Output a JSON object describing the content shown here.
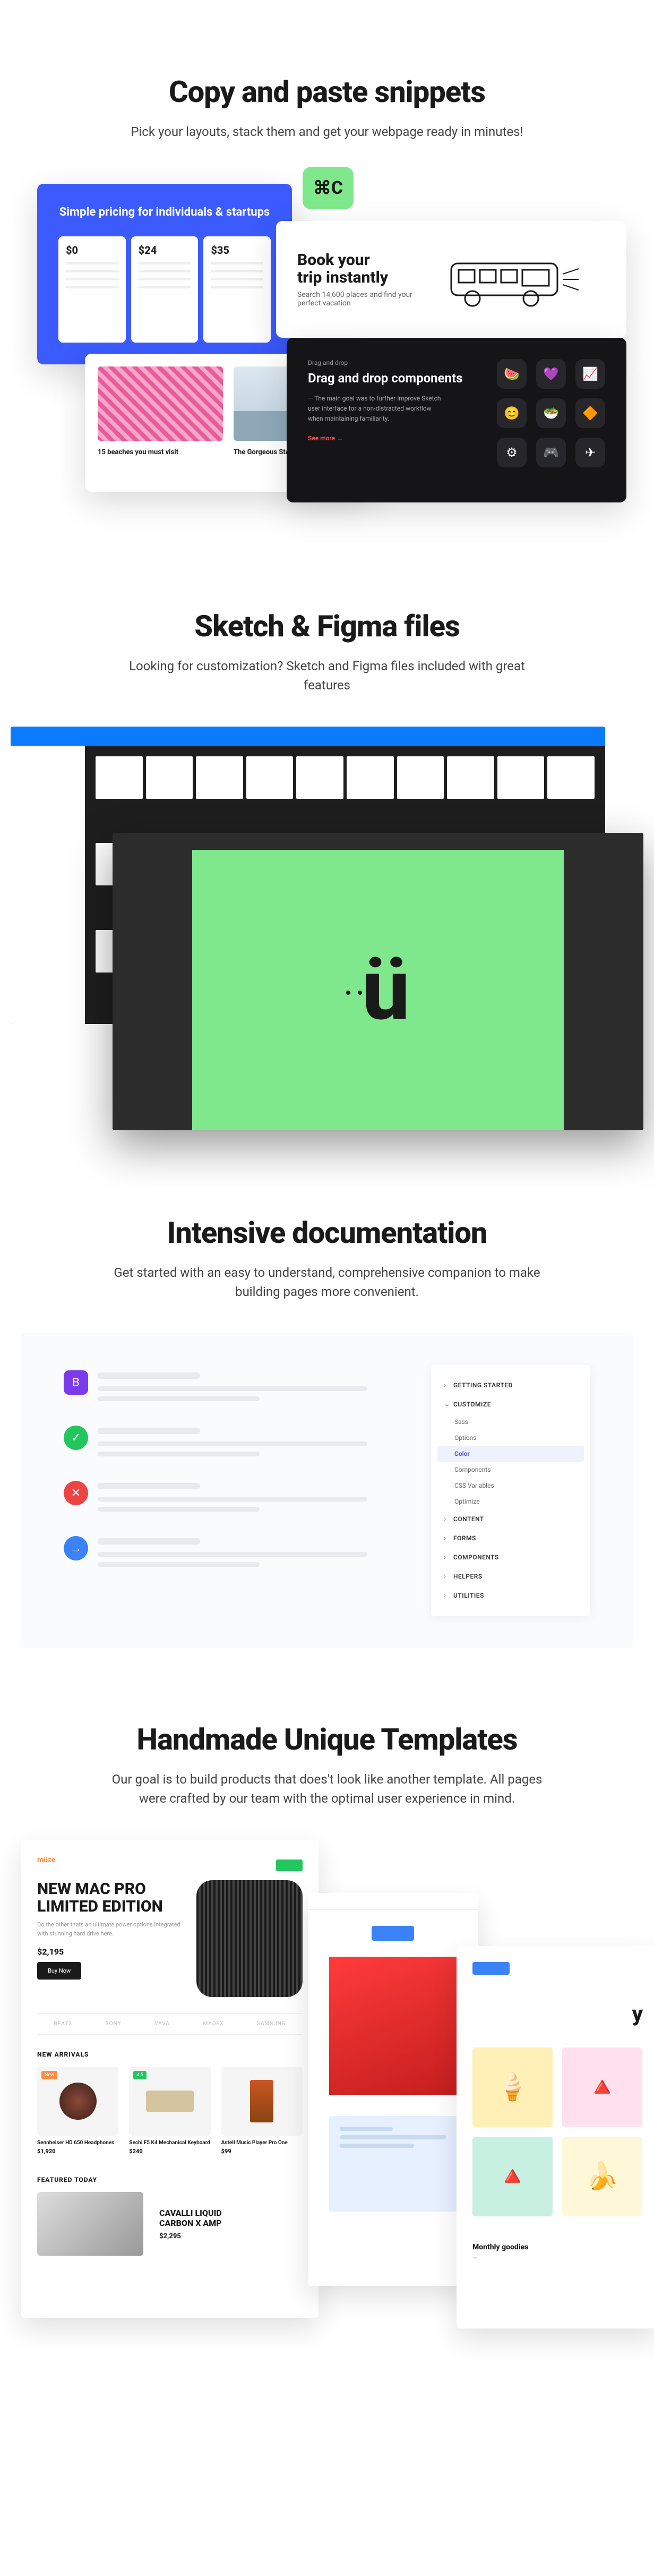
{
  "sec1": {
    "title": "Copy and paste snippets",
    "sub": "Pick your layouts, stack them and get your webpage ready in minutes!",
    "pricing_heading": "Simple pricing for individuals & startups",
    "prices": [
      "$0",
      "$24",
      "$35"
    ],
    "badge": "⌘C",
    "trip_title_l1": "Book your",
    "trip_title_l2": "trip instantly",
    "trip_sub": "Search 14,600 places and find your perfect vacation",
    "beach_cap1": "15 beaches you must visit",
    "beach_cap2": "The Gorgeous Statue Thailand",
    "dark_eyebrow": "Drag and drop",
    "dark_title": "Drag and drop components",
    "dark_body": "— The main goal was to further improve Sketch user interface for a non-distracted workflow when maintaining familiarity.",
    "dark_more": "See more →",
    "icons": [
      "🍉",
      "💜",
      "📈",
      "😊",
      "🥗",
      "🔶",
      "⚙",
      "🎮",
      "✈"
    ]
  },
  "sec2": {
    "title": "Sketch & Figma files",
    "sub": "Looking for customization? Sketch and Figma files included with great features",
    "logo": "ü"
  },
  "sec3": {
    "title": "Intensive documentation",
    "sub": "Get started with an easy to understand, comprehensive companion to make building pages more convenient.",
    "nav": {
      "getting_started": "GETTING STARTED",
      "customize": "CUSTOMIZE",
      "sass": "Sass",
      "options": "Options",
      "color": "Color",
      "components": "Components",
      "css_vars": "CSS Variables",
      "optimize": "Optimize",
      "content": "CONTENT",
      "forms": "FORMS",
      "components_top": "COMPONENTS",
      "helpers": "HELPERS",
      "utilities": "UTILITIES"
    },
    "icons": {
      "b": "B",
      "check": "✓",
      "x": "✕",
      "arrow": "→"
    }
  },
  "sec4": {
    "title": "Handmade Unique Templates",
    "sub": "Our goal is to build products that does't look like another template. All pages were crafted by our team with the optimal user experience in mind.",
    "t1": {
      "logo": "müze",
      "hero_title": "NEW MAC PRO LIMITED EDITION",
      "hero_body": "Do the other thats an ultimate power options integrated with stunning hard drive here.",
      "price": "$2,195",
      "buy": "Buy Now",
      "brands": [
        "BEATS",
        "SONY",
        "VAVA",
        "MADEX",
        "SAMSUNG"
      ],
      "new_arrivals": "NEW ARRIVALS",
      "prods": [
        {
          "badge": "New",
          "badge_c": "#ff8c42",
          "name": "Sennheiser HD 650 Headphones",
          "price": "$1,920"
        },
        {
          "badge": "4.5",
          "badge_c": "#22c55e",
          "name": "Sechi F5 K4 Mechanical Keyboard",
          "price": "$240"
        },
        {
          "badge": "",
          "badge_c": "",
          "name": "Astell Music Player Pro One",
          "price": "$99"
        }
      ],
      "featured": "FEATURED TODAY",
      "feat_name": "CAVALLI LIQUID CARBON X AMP",
      "feat_price": "$2,295"
    },
    "t3": {
      "title": "y",
      "tiles": [
        "🍦",
        "🔺",
        "🔺",
        "🍌"
      ],
      "mg": "Monthly goodies"
    }
  }
}
